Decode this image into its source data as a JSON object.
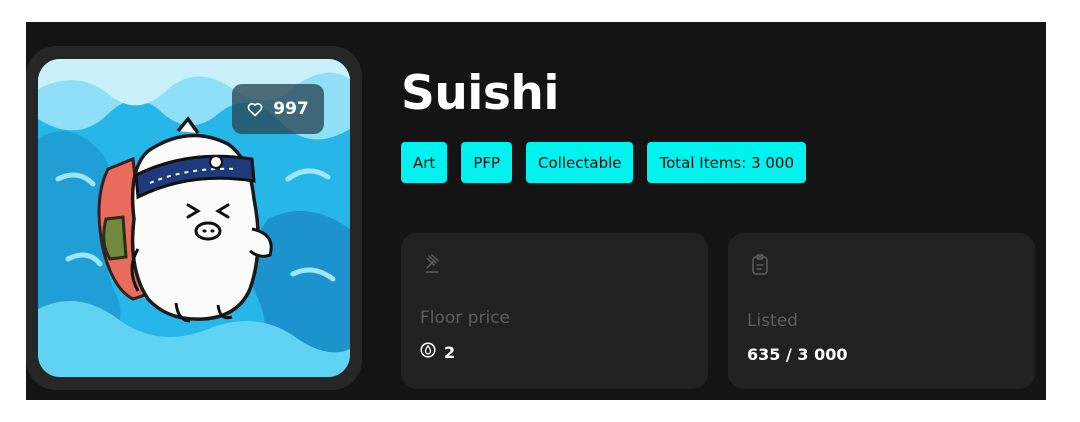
{
  "collection": {
    "title": "Suishi",
    "likes": "997",
    "tags": [
      "Art",
      "PFP",
      "Collectable",
      "Total Items: 3 000"
    ]
  },
  "stats": {
    "floor": {
      "label": "Floor price",
      "value": "2",
      "icon": "gavel-icon",
      "currency_icon": "token-icon"
    },
    "listed": {
      "label": "Listed",
      "value": "635 / 3 000",
      "icon": "clipboard-icon"
    }
  },
  "colors": {
    "panel": "#141414",
    "card": "#212121",
    "tag": "#00f2ee",
    "artwork_frame": "#262626"
  }
}
